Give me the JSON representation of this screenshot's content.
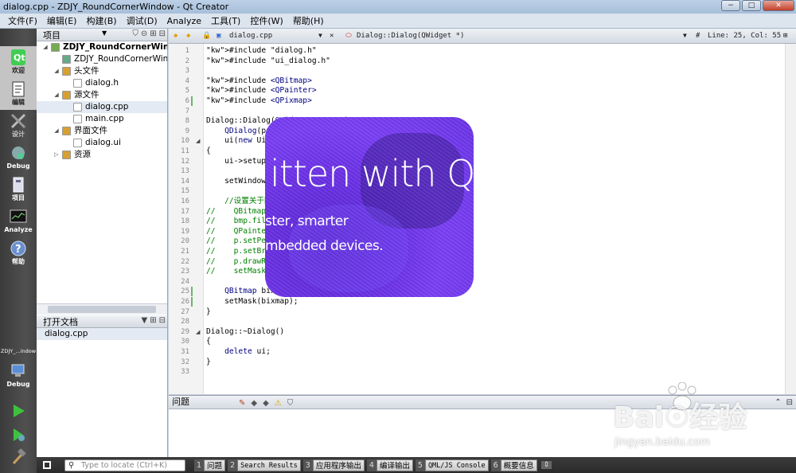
{
  "window": {
    "title": "dialog.cpp - ZDJY_RoundCornerWindow - Qt Creator",
    "buttons": [
      "−",
      "□",
      "✕"
    ]
  },
  "menu": [
    "文件(F)",
    "编辑(E)",
    "构建(B)",
    "调试(D)",
    "Analyze",
    "工具(T)",
    "控件(W)",
    "帮助(H)"
  ],
  "modes": [
    {
      "label": "欢迎",
      "icon": "qt-logo-icon"
    },
    {
      "label": "编辑",
      "icon": "edit-document-icon"
    },
    {
      "label": "设计",
      "icon": "design-tools-icon"
    },
    {
      "label": "Debug",
      "icon": "debug-bug-icon"
    },
    {
      "label": "项目",
      "icon": "project-icon"
    },
    {
      "label": "Analyze",
      "icon": "analyze-monitor-icon"
    },
    {
      "label": "帮助",
      "icon": "help-icon"
    }
  ],
  "target": {
    "name": "ZDJY_...indow",
    "mode": "Debug"
  },
  "project_panel": {
    "title": "项目",
    "tree": [
      {
        "text": "ZDJY_RoundCornerWindo",
        "level": 0,
        "bold": true,
        "exp": "◢"
      },
      {
        "text": "ZDJY_RoundCornerWind",
        "level": 1,
        "bold": false,
        "exp": ""
      },
      {
        "text": "头文件",
        "level": 1,
        "bold": false,
        "exp": "◢"
      },
      {
        "text": "dialog.h",
        "level": 2,
        "bold": false,
        "exp": ""
      },
      {
        "text": "源文件",
        "level": 1,
        "bold": false,
        "exp": "◢"
      },
      {
        "text": "dialog.cpp",
        "level": 2,
        "bold": false,
        "exp": "",
        "selected": true
      },
      {
        "text": "main.cpp",
        "level": 2,
        "bold": false,
        "exp": ""
      },
      {
        "text": "界面文件",
        "level": 1,
        "bold": false,
        "exp": "◢"
      },
      {
        "text": "dialog.ui",
        "level": 2,
        "bold": false,
        "exp": ""
      },
      {
        "text": "资源",
        "level": 1,
        "bold": false,
        "exp": "▷"
      }
    ]
  },
  "open_docs": {
    "title": "打开文档",
    "items": [
      "dialog.cpp"
    ]
  },
  "editor_toolbar": {
    "file": "dialog.cpp",
    "symbol": "Dialog::Dialog(QWidget *)",
    "position": "Line: 25, Col: 55"
  },
  "code_lines": [
    {
      "n": 1,
      "t": "#include \"dialog.h\""
    },
    {
      "n": 2,
      "t": "#include \"ui_dialog.h\""
    },
    {
      "n": 3,
      "t": ""
    },
    {
      "n": 4,
      "t": "#include <QBitmap>"
    },
    {
      "n": 5,
      "t": "#include <QPainter>"
    },
    {
      "n": 6,
      "t": "#include <QPixmap>"
    },
    {
      "n": 7,
      "t": ""
    },
    {
      "n": 8,
      "t": "Dialog::Dialog(QWidget *parent) :"
    },
    {
      "n": 9,
      "t": "    QDialog(parent),"
    },
    {
      "n": 10,
      "t": "    ui(new Ui::Dialog)"
    },
    {
      "n": 11,
      "t": "{"
    },
    {
      "n": 12,
      "t": "    ui->setupUi(this);"
    },
    {
      "n": 13,
      "t": ""
    },
    {
      "n": 14,
      "t": "    setWindowFlags(Qt::FramelessWindowHint);"
    },
    {
      "n": 15,
      "t": ""
    },
    {
      "n": 16,
      "t": "    //设置关于圆角"
    },
    {
      "n": 17,
      "t": "//    QBitmap bmp(this->size());"
    },
    {
      "n": 18,
      "t": "//    bmp.fill();"
    },
    {
      "n": 19,
      "t": "//    QPainter p(&bmp);"
    },
    {
      "n": 20,
      "t": "//    p.setPen(Qt::NoPen);"
    },
    {
      "n": 21,
      "t": "//    p.setBrush(Qt::black);"
    },
    {
      "n": 22,
      "t": "//    p.drawRoundedRect(bmp.rect(),20,20);"
    },
    {
      "n": 23,
      "t": "//    setMask(bmp);"
    },
    {
      "n": 24,
      "t": ""
    },
    {
      "n": 25,
      "t": "    QBitmap bixmap(\":/pictures/pictures/mask.jpg\");"
    },
    {
      "n": 26,
      "t": "    setMask(bixmap);"
    },
    {
      "n": 27,
      "t": "}"
    },
    {
      "n": 28,
      "t": ""
    },
    {
      "n": 29,
      "t": "Dialog::~Dialog()"
    },
    {
      "n": 30,
      "t": "{"
    },
    {
      "n": 31,
      "t": "    delete ui;"
    },
    {
      "n": 32,
      "t": "}"
    },
    {
      "n": 33,
      "t": ""
    }
  ],
  "splash": {
    "line1": "itten with Q",
    "line2": "ster, smarter",
    "line3": "mbedded devices."
  },
  "issues": {
    "title": "问题"
  },
  "statusbar": {
    "locate_placeholder": "Type to locate (Ctrl+K)",
    "tabs": [
      {
        "n": "1",
        "label": "问题",
        "mono": false
      },
      {
        "n": "2",
        "label": "Search Results",
        "mono": true
      },
      {
        "n": "3",
        "label": "应用程序输出",
        "mono": false
      },
      {
        "n": "4",
        "label": "编译输出",
        "mono": false
      },
      {
        "n": "5",
        "label": "QML/JS Console",
        "mono": true
      },
      {
        "n": "6",
        "label": "概要信息",
        "mono": false
      }
    ]
  },
  "watermark": {
    "brand": "Bai☉经验",
    "url": "jingyan.baidu.com"
  }
}
